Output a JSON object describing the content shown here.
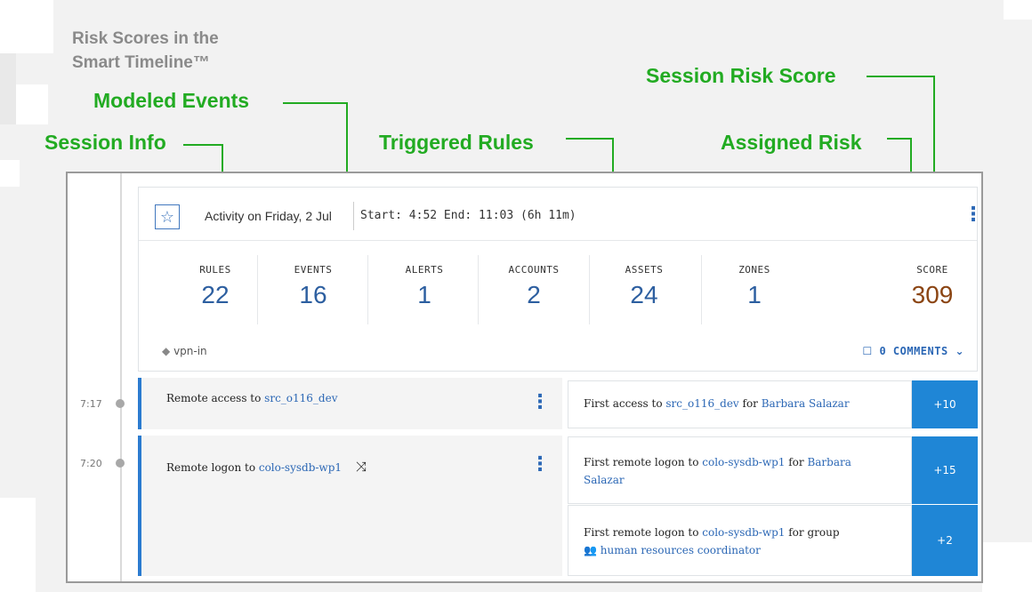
{
  "title": "Risk Scores in the Smart Timeline™",
  "annotations": {
    "modeled_events": "Modeled Events",
    "session_info": "Session Info",
    "triggered_rules": "Triggered Rules",
    "session_risk_score": "Session Risk Score",
    "assigned_risk": "Assigned Risk"
  },
  "colors": {
    "annotation": "#22ab22",
    "accent_blue": "#2b67b5",
    "risk_cell": "#1f86d6",
    "score": "#8b4513"
  },
  "session": {
    "activity": "Activity on Friday, 2 Jul",
    "time_range": "Start: 4:52 End: 11:03 (6h 11m)",
    "stats": [
      {
        "label": "RULES",
        "value": "22"
      },
      {
        "label": "EVENTS",
        "value": "16"
      },
      {
        "label": "ALERTS",
        "value": "1"
      },
      {
        "label": "ACCOUNTS",
        "value": "2"
      },
      {
        "label": "ASSETS",
        "value": "24"
      },
      {
        "label": "ZONES",
        "value": "1"
      }
    ],
    "score": {
      "label": "SCORE",
      "value": "309"
    },
    "tag": "vpn-in",
    "comments": "0 COMMENTS"
  },
  "timeline": [
    {
      "time": "7:17",
      "event": {
        "prefix": "Remote access to ",
        "link": "src_o116_dev"
      },
      "rules": [
        {
          "prefix": "First access to ",
          "link": "src_o116_dev",
          "mid": " for ",
          "link2": "Barbara Salazar",
          "risk": "+10"
        }
      ]
    },
    {
      "time": "7:20",
      "event": {
        "prefix": "Remote logon to ",
        "link": "colo-sysdb-wp1"
      },
      "rules": [
        {
          "prefix": "First remote logon to ",
          "link": "colo-sysdb-wp1",
          "mid": " for ",
          "link2": "Barbara Salazar",
          "risk": "+15"
        },
        {
          "prefix": "First remote logon to ",
          "link": "colo-sysdb-wp1",
          "mid": " for group",
          "link2": "human resources coordinator",
          "risk": "+2"
        }
      ]
    }
  ],
  "icons": [
    "star-icon",
    "kebab-menu-icon",
    "tag-icon",
    "comment-icon",
    "chevron-down-icon",
    "shuffle-icon",
    "group-icon"
  ]
}
